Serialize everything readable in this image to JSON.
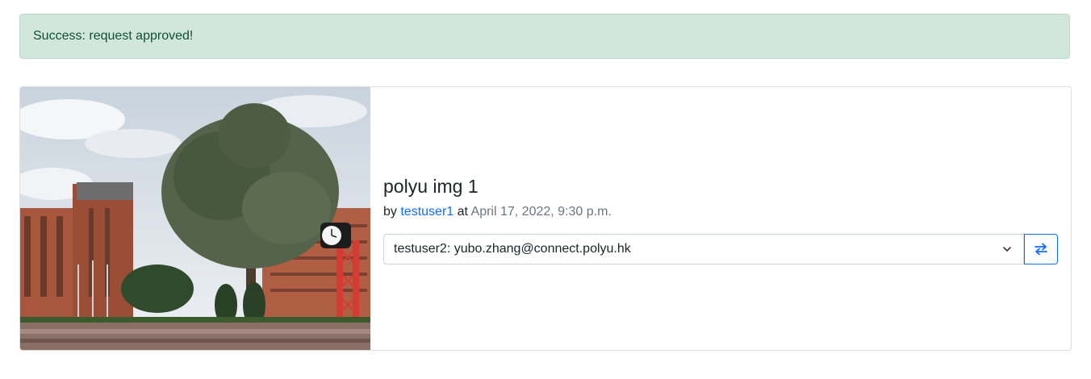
{
  "alert": {
    "message": "Success: request approved!",
    "color": "#d1e7dd"
  },
  "card": {
    "image_alt": "polyu campus photo with tree and clock tower",
    "title": "polyu img 1",
    "by_prefix": "by",
    "author": "testuser1",
    "at_word": "at",
    "timestamp": "April 17, 2022, 9:30 p.m.",
    "select": {
      "selected_value": "testuser2: yubo.zhang@connect.polyu.hk"
    },
    "swap_button_icon": "swap-arrows-icon"
  },
  "colors": {
    "link": "#0d6efd",
    "muted": "#6c757d"
  }
}
